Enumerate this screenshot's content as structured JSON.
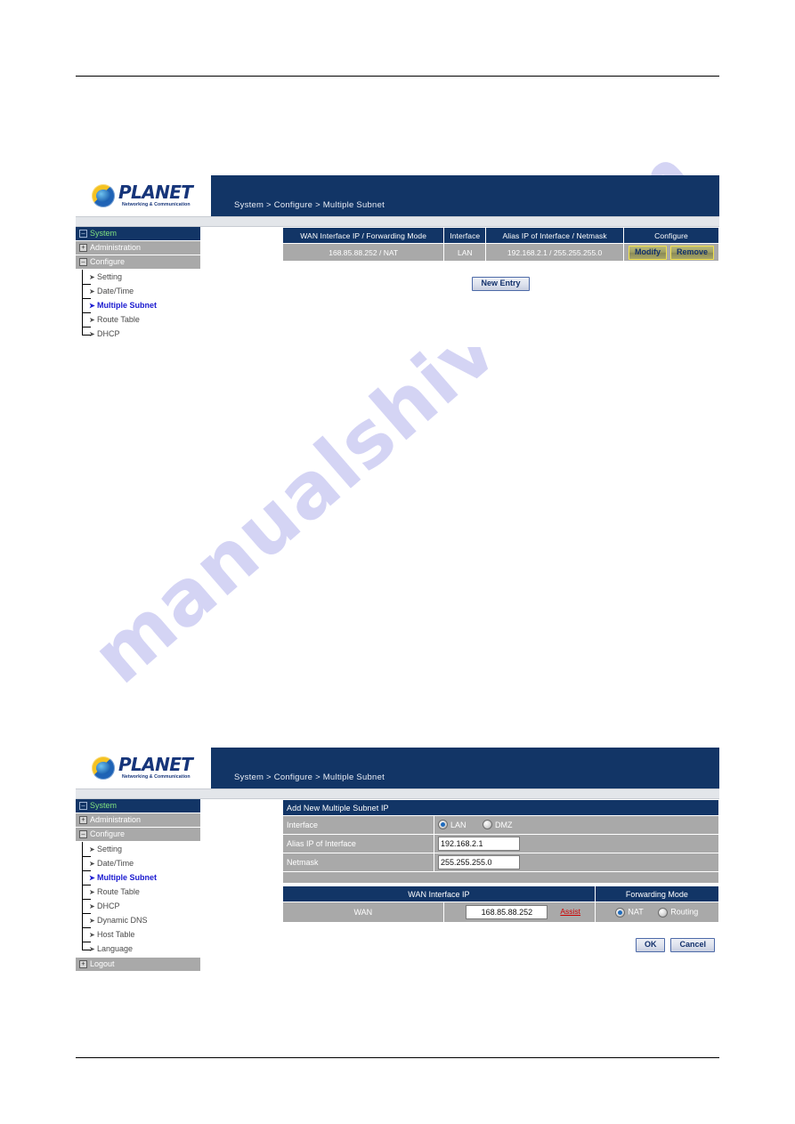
{
  "watermark": {
    "text": "manualshive.com"
  },
  "brand": {
    "name": "PLANET",
    "tagline": "Networking & Communication"
  },
  "screen_top": {
    "breadcrumb": "System > Configure > Multiple Subnet",
    "sidebar": {
      "header": {
        "label": "System",
        "expander": "–"
      },
      "groups": [
        {
          "label": "Administration",
          "expander": "+"
        },
        {
          "label": "Configure",
          "expander": "–"
        }
      ],
      "items": [
        {
          "label": "Setting",
          "active": false
        },
        {
          "label": "Date/Time",
          "active": false
        },
        {
          "label": "Multiple Subnet",
          "active": true
        },
        {
          "label": "Route Table",
          "active": false
        },
        {
          "label": "DHCP",
          "active": false
        }
      ]
    },
    "table": {
      "headers": [
        "WAN Interface IP / Forwarding Mode",
        "Interface",
        "Alias IP of Interface / Netmask",
        "Configure"
      ],
      "rows": [
        {
          "wan_ip_mode": "168.85.88.252 / NAT",
          "interface": "LAN",
          "alias_ip_netmask": "192.168.2.1 / 255.255.255.0",
          "modify_label": "Modify",
          "remove_label": "Remove"
        }
      ]
    },
    "new_entry_label": "New  Entry"
  },
  "screen_bottom": {
    "breadcrumb": "System > Configure > Multiple Subnet",
    "sidebar": {
      "header": {
        "label": "System",
        "expander": "–"
      },
      "groups": [
        {
          "label": "Administration",
          "expander": "+"
        },
        {
          "label": "Configure",
          "expander": "–"
        }
      ],
      "items": [
        {
          "label": "Setting",
          "active": false
        },
        {
          "label": "Date/Time",
          "active": false
        },
        {
          "label": "Multiple Subnet",
          "active": true
        },
        {
          "label": "Route Table",
          "active": false
        },
        {
          "label": "DHCP",
          "active": false
        },
        {
          "label": "Dynamic DNS",
          "active": false
        },
        {
          "label": "Host Table",
          "active": false
        },
        {
          "label": "Language",
          "active": false
        }
      ],
      "footer": {
        "label": "Logout",
        "expander": "+"
      }
    },
    "form": {
      "title": "Add New Multiple Subnet IP",
      "interface_label": "Interface",
      "interface_options": [
        {
          "label": "LAN",
          "selected": true
        },
        {
          "label": "DMZ",
          "selected": false
        }
      ],
      "alias_ip_label": "Alias IP of Interface",
      "alias_ip_value": "192.168.2.1",
      "netmask_label": "Netmask",
      "netmask_value": "255.255.255.0",
      "wan_section_header": "WAN Interface IP",
      "forwarding_mode_header": "Forwarding Mode",
      "wan_row_label": "WAN",
      "wan_ip_value": "168.85.88.252",
      "assist_label": "Assist",
      "forwarding_options": [
        {
          "label": "NAT",
          "selected": true
        },
        {
          "label": "Routing",
          "selected": false
        }
      ],
      "ok_label": "OK",
      "cancel_label": "Cancel"
    }
  }
}
